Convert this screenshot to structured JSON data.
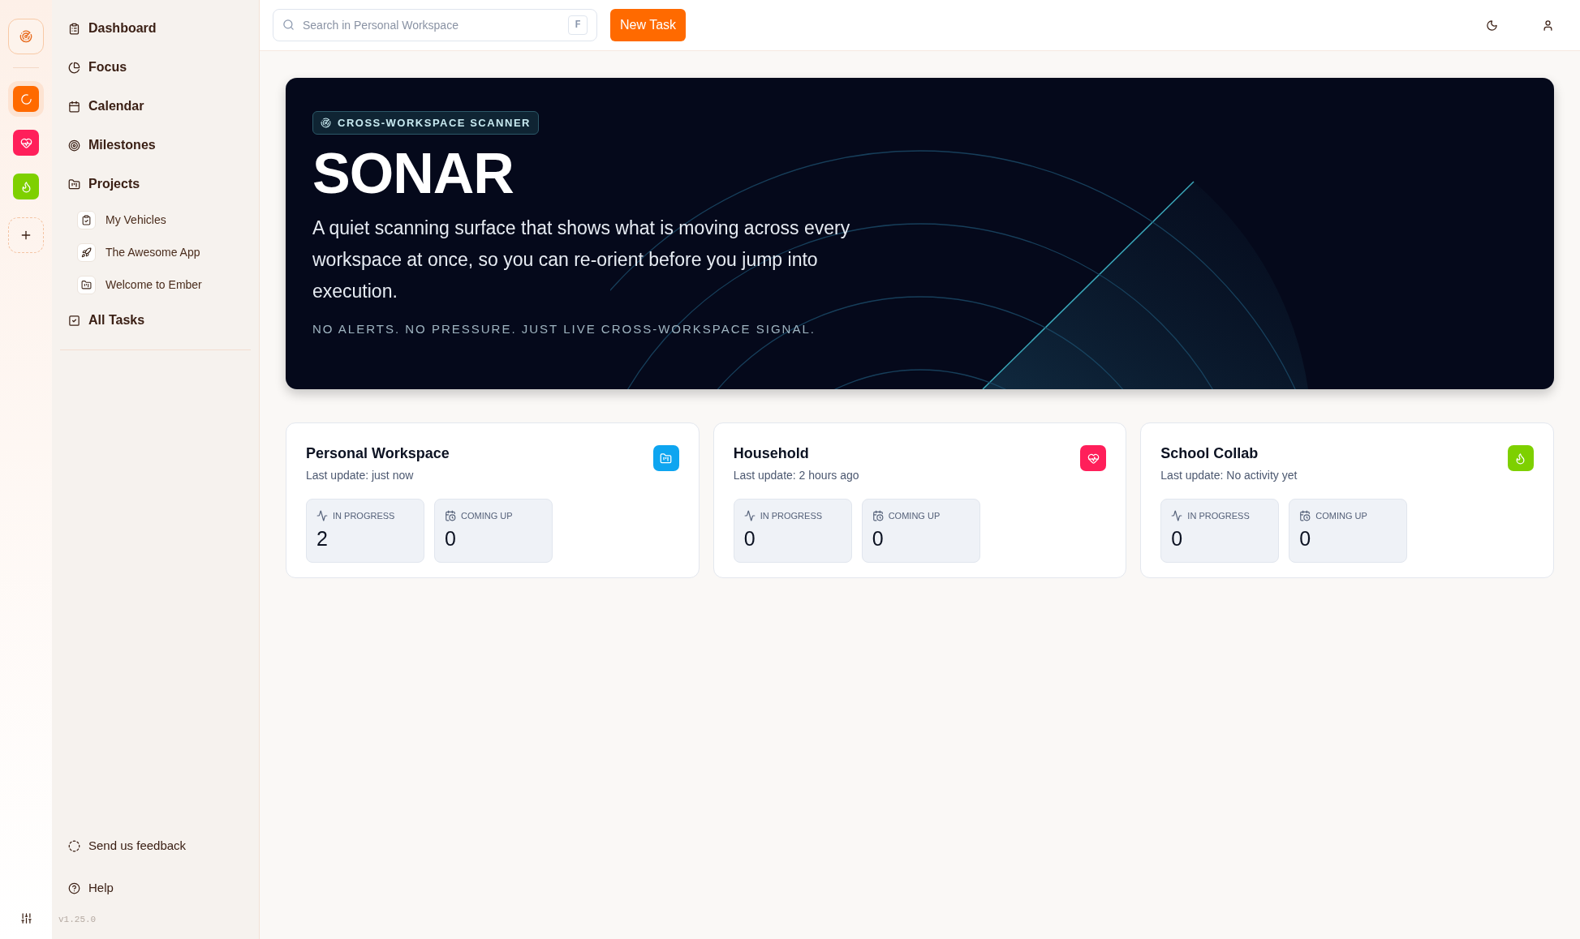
{
  "rail": {
    "workspaces": [
      {
        "kind": "spinner",
        "color": "#ff6a00",
        "selected": true
      },
      {
        "kind": "heart",
        "color": "#ff1f5a",
        "selected": false
      },
      {
        "kind": "flame",
        "color": "#7ed000",
        "selected": false
      }
    ]
  },
  "sidebar": {
    "items": [
      {
        "kind": "clipboard",
        "label": "Dashboard"
      },
      {
        "kind": "pie",
        "label": "Focus"
      },
      {
        "kind": "calendar",
        "label": "Calendar"
      },
      {
        "kind": "target",
        "label": "Milestones"
      },
      {
        "kind": "folder",
        "label": "Projects",
        "children": [
          {
            "kind": "clipboard-check",
            "label": "My Vehicles"
          },
          {
            "kind": "rocket",
            "label": "The Awesome App"
          },
          {
            "kind": "folder",
            "label": "Welcome to Ember"
          }
        ]
      },
      {
        "kind": "check-square",
        "label": "All Tasks"
      }
    ],
    "footer": [
      {
        "kind": "dashed-circle",
        "label": "Send us feedback"
      },
      {
        "kind": "help",
        "label": "Help"
      }
    ],
    "version": "v1.25.0"
  },
  "topbar": {
    "search": {
      "placeholder": "Search in Personal Workspace",
      "shortcut": "F"
    },
    "new_task_button": "New Task"
  },
  "hero": {
    "badge": "CROSS-WORKSPACE SCANNER",
    "title": "SONAR",
    "description": "A quiet scanning surface that shows what is moving across every workspace at once, so you can re-orient before you jump into execution.",
    "tagline": "NO ALERTS. NO PRESSURE. JUST LIVE CROSS-WORKSPACE SIGNAL."
  },
  "workspaces": [
    {
      "name": "Personal Workspace",
      "last_update": "Last update: just now",
      "kind": "folder",
      "color": "#0ea5f0",
      "stats": [
        {
          "kind": "progress",
          "label": "IN PROGRESS",
          "value": "2"
        },
        {
          "kind": "upcoming",
          "label": "COMING UP",
          "value": "0"
        }
      ]
    },
    {
      "name": "Household",
      "last_update": "Last update: 2 hours ago",
      "kind": "heart",
      "color": "#ff1f5a",
      "stats": [
        {
          "kind": "progress",
          "label": "IN PROGRESS",
          "value": "0"
        },
        {
          "kind": "upcoming",
          "label": "COMING UP",
          "value": "0"
        }
      ]
    },
    {
      "name": "School Collab",
      "last_update": "Last update: No activity yet",
      "kind": "flame",
      "color": "#7ed000",
      "stats": [
        {
          "kind": "progress",
          "label": "IN PROGRESS",
          "value": "0"
        },
        {
          "kind": "upcoming",
          "label": "COMING UP",
          "value": "0"
        }
      ]
    }
  ]
}
